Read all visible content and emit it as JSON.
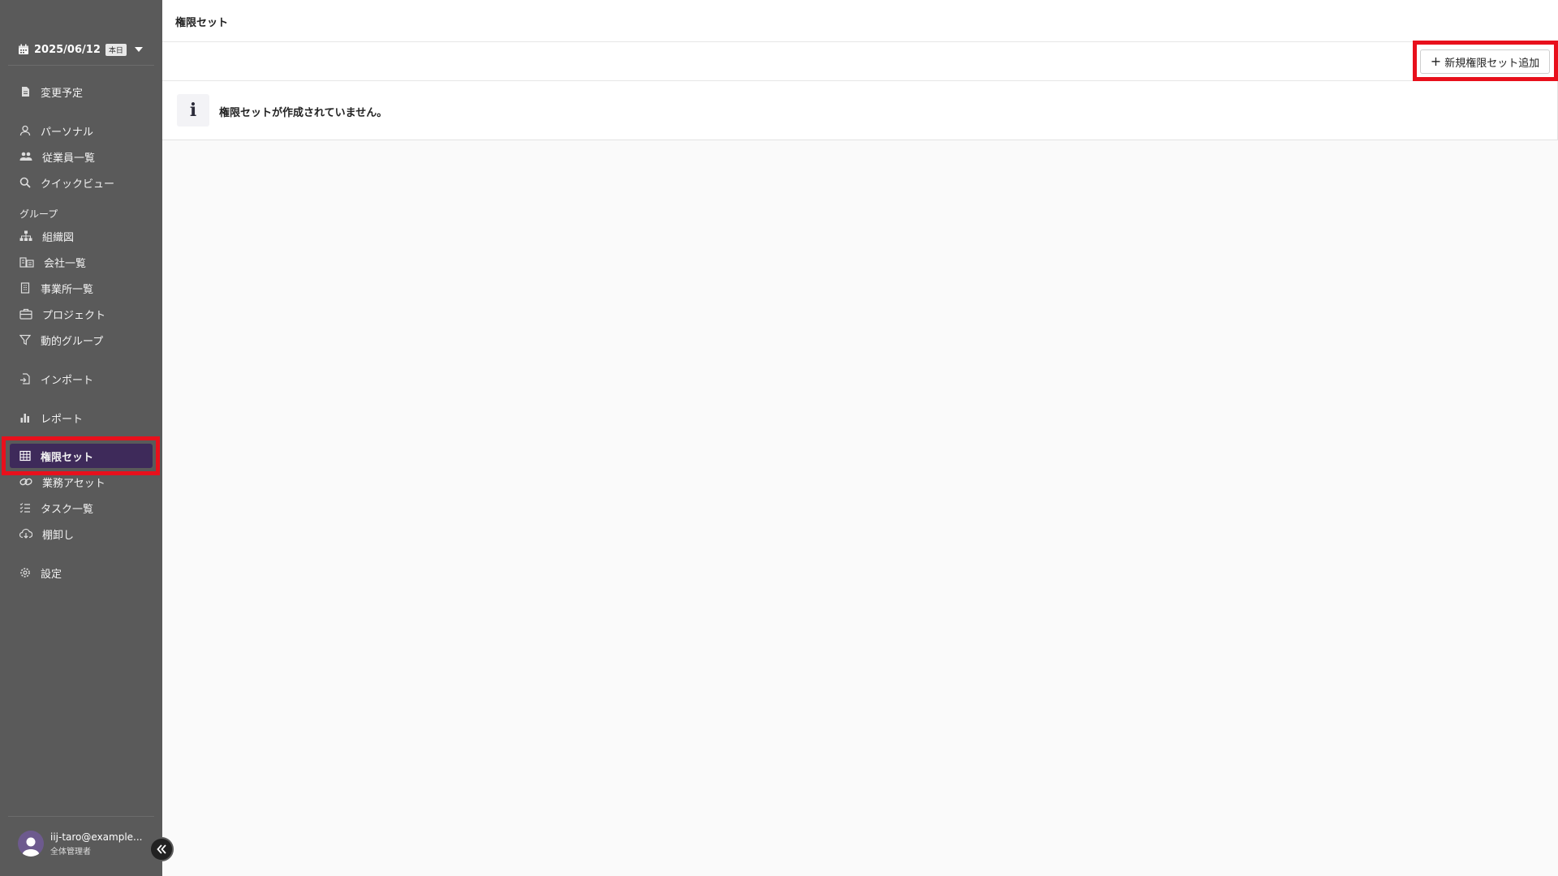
{
  "sidebar": {
    "date": "2025/06/12",
    "today_badge": "本日",
    "items": [
      {
        "label": "変更予定",
        "icon": "document-icon"
      },
      {
        "label": "パーソナル",
        "icon": "person-icon"
      },
      {
        "label": "従業員一覧",
        "icon": "people-icon"
      },
      {
        "label": "クイックビュー",
        "icon": "search-icon"
      },
      {
        "label": "組織図",
        "icon": "org-chart-icon"
      },
      {
        "label": "会社一覧",
        "icon": "buildings-icon"
      },
      {
        "label": "事業所一覧",
        "icon": "office-icon"
      },
      {
        "label": "プロジェクト",
        "icon": "briefcase-icon"
      },
      {
        "label": "動的グループ",
        "icon": "filter-icon"
      },
      {
        "label": "インポート",
        "icon": "import-icon"
      },
      {
        "label": "レポート",
        "icon": "bar-chart-icon"
      },
      {
        "label": "権限セット",
        "icon": "grid-icon"
      },
      {
        "label": "業務アセット",
        "icon": "link-icon"
      },
      {
        "label": "タスク一覧",
        "icon": "checklist-icon"
      },
      {
        "label": "棚卸し",
        "icon": "cloud-download-icon"
      },
      {
        "label": "設定",
        "icon": "gear-icon"
      }
    ],
    "group_label": "グループ",
    "active_item": "権限セット",
    "user": {
      "email": "iij-taro@example...",
      "role": "全体管理者"
    }
  },
  "header": {
    "title": "権限セット"
  },
  "toolbar": {
    "add_label": "新規権限セット追加"
  },
  "info": {
    "message": "権限セットが作成されていません。"
  },
  "colors": {
    "sidebar_bg": "#5a5a5a",
    "active_bg": "#3e2a5a",
    "highlight": "#e8101c"
  }
}
